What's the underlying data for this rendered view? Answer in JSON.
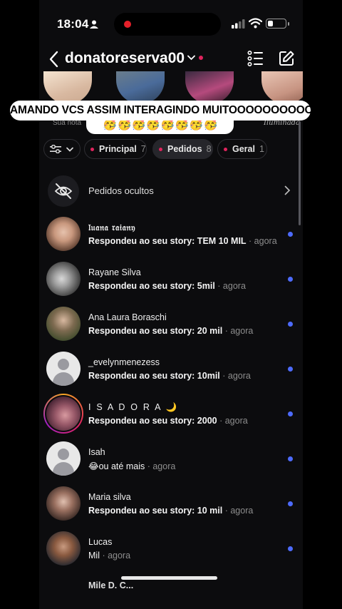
{
  "status_bar": {
    "time": "18:04",
    "battery_level": 0.32
  },
  "header": {
    "username": "donatoreserva00"
  },
  "notes": [
    {
      "label": "Sua nota"
    },
    {
      "label": ""
    },
    {
      "label": ""
    },
    {
      "label": "Iluminada"
    }
  ],
  "caption": {
    "line1": "AMANDO VCS ASSIM INTERAGINDO MUITOOOOOOOOOO",
    "line2": "🥳🥳🥳🥳🥳🥳🥳🥳"
  },
  "filters": {
    "principal_label": "Principal",
    "principal_count": "7",
    "pedidos_label": "Pedidos",
    "pedidos_count": "8",
    "geral_label": "Geral",
    "geral_count": "1"
  },
  "hidden_requests": {
    "label": "Pedidos ocultos"
  },
  "requests": [
    {
      "name": "𝔩𝔲𝔞𝔫𝔞 𝔯𝔞𝔦𝔞𝔫𝔶",
      "message": "Respondeu ao seu story: TEM 10 MIL",
      "time": " · agora"
    },
    {
      "name": "Rayane Silva",
      "message": "Respondeu ao seu story: 5mil",
      "time": " · agora"
    },
    {
      "name": "Ana Laura Boraschi",
      "message": "Respondeu ao seu story: 20 mil",
      "time": " · agora"
    },
    {
      "name": "_evelynmenezess",
      "message": "Respondeu ao seu story: 10mil",
      "time": " · agora"
    },
    {
      "name": "I S A D O R A 🌙",
      "message": "Respondeu ao seu story: 2000",
      "time": " · agora"
    },
    {
      "name": "Isah",
      "message": "😂ou até mais",
      "time": " · agora"
    },
    {
      "name": "Maria silva",
      "message": "Respondeu ao seu story: 10 mil",
      "time": " · agora"
    },
    {
      "name": "Lucas",
      "message": "Mil",
      "time": " · agora"
    }
  ],
  "partial_row": {
    "name": "Mile D. C..."
  },
  "colors": {
    "unread": "#4d6bfe",
    "accent_dot": "#e0245e",
    "background": "#0c0c0e"
  }
}
